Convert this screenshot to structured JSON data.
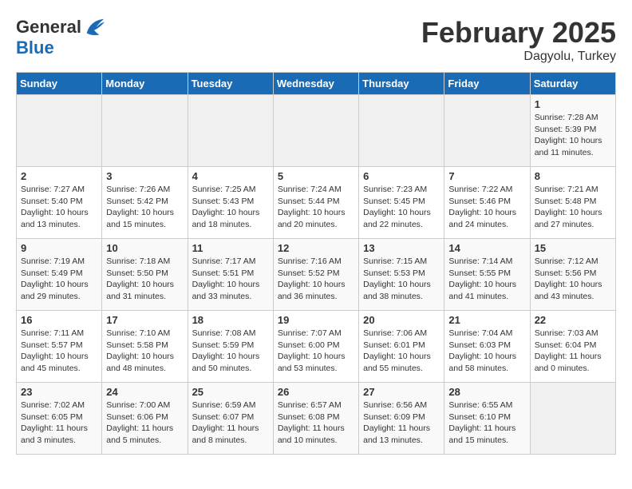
{
  "header": {
    "logo_line1": "General",
    "logo_line2": "Blue",
    "month_title": "February 2025",
    "location": "Dagyolu, Turkey"
  },
  "days_of_week": [
    "Sunday",
    "Monday",
    "Tuesday",
    "Wednesday",
    "Thursday",
    "Friday",
    "Saturday"
  ],
  "weeks": [
    [
      {
        "day": "",
        "info": ""
      },
      {
        "day": "",
        "info": ""
      },
      {
        "day": "",
        "info": ""
      },
      {
        "day": "",
        "info": ""
      },
      {
        "day": "",
        "info": ""
      },
      {
        "day": "",
        "info": ""
      },
      {
        "day": "1",
        "info": "Sunrise: 7:28 AM\nSunset: 5:39 PM\nDaylight: 10 hours\nand 11 minutes."
      }
    ],
    [
      {
        "day": "2",
        "info": "Sunrise: 7:27 AM\nSunset: 5:40 PM\nDaylight: 10 hours\nand 13 minutes."
      },
      {
        "day": "3",
        "info": "Sunrise: 7:26 AM\nSunset: 5:42 PM\nDaylight: 10 hours\nand 15 minutes."
      },
      {
        "day": "4",
        "info": "Sunrise: 7:25 AM\nSunset: 5:43 PM\nDaylight: 10 hours\nand 18 minutes."
      },
      {
        "day": "5",
        "info": "Sunrise: 7:24 AM\nSunset: 5:44 PM\nDaylight: 10 hours\nand 20 minutes."
      },
      {
        "day": "6",
        "info": "Sunrise: 7:23 AM\nSunset: 5:45 PM\nDaylight: 10 hours\nand 22 minutes."
      },
      {
        "day": "7",
        "info": "Sunrise: 7:22 AM\nSunset: 5:46 PM\nDaylight: 10 hours\nand 24 minutes."
      },
      {
        "day": "8",
        "info": "Sunrise: 7:21 AM\nSunset: 5:48 PM\nDaylight: 10 hours\nand 27 minutes."
      }
    ],
    [
      {
        "day": "9",
        "info": "Sunrise: 7:19 AM\nSunset: 5:49 PM\nDaylight: 10 hours\nand 29 minutes."
      },
      {
        "day": "10",
        "info": "Sunrise: 7:18 AM\nSunset: 5:50 PM\nDaylight: 10 hours\nand 31 minutes."
      },
      {
        "day": "11",
        "info": "Sunrise: 7:17 AM\nSunset: 5:51 PM\nDaylight: 10 hours\nand 33 minutes."
      },
      {
        "day": "12",
        "info": "Sunrise: 7:16 AM\nSunset: 5:52 PM\nDaylight: 10 hours\nand 36 minutes."
      },
      {
        "day": "13",
        "info": "Sunrise: 7:15 AM\nSunset: 5:53 PM\nDaylight: 10 hours\nand 38 minutes."
      },
      {
        "day": "14",
        "info": "Sunrise: 7:14 AM\nSunset: 5:55 PM\nDaylight: 10 hours\nand 41 minutes."
      },
      {
        "day": "15",
        "info": "Sunrise: 7:12 AM\nSunset: 5:56 PM\nDaylight: 10 hours\nand 43 minutes."
      }
    ],
    [
      {
        "day": "16",
        "info": "Sunrise: 7:11 AM\nSunset: 5:57 PM\nDaylight: 10 hours\nand 45 minutes."
      },
      {
        "day": "17",
        "info": "Sunrise: 7:10 AM\nSunset: 5:58 PM\nDaylight: 10 hours\nand 48 minutes."
      },
      {
        "day": "18",
        "info": "Sunrise: 7:08 AM\nSunset: 5:59 PM\nDaylight: 10 hours\nand 50 minutes."
      },
      {
        "day": "19",
        "info": "Sunrise: 7:07 AM\nSunset: 6:00 PM\nDaylight: 10 hours\nand 53 minutes."
      },
      {
        "day": "20",
        "info": "Sunrise: 7:06 AM\nSunset: 6:01 PM\nDaylight: 10 hours\nand 55 minutes."
      },
      {
        "day": "21",
        "info": "Sunrise: 7:04 AM\nSunset: 6:03 PM\nDaylight: 10 hours\nand 58 minutes."
      },
      {
        "day": "22",
        "info": "Sunrise: 7:03 AM\nSunset: 6:04 PM\nDaylight: 11 hours\nand 0 minutes."
      }
    ],
    [
      {
        "day": "23",
        "info": "Sunrise: 7:02 AM\nSunset: 6:05 PM\nDaylight: 11 hours\nand 3 minutes."
      },
      {
        "day": "24",
        "info": "Sunrise: 7:00 AM\nSunset: 6:06 PM\nDaylight: 11 hours\nand 5 minutes."
      },
      {
        "day": "25",
        "info": "Sunrise: 6:59 AM\nSunset: 6:07 PM\nDaylight: 11 hours\nand 8 minutes."
      },
      {
        "day": "26",
        "info": "Sunrise: 6:57 AM\nSunset: 6:08 PM\nDaylight: 11 hours\nand 10 minutes."
      },
      {
        "day": "27",
        "info": "Sunrise: 6:56 AM\nSunset: 6:09 PM\nDaylight: 11 hours\nand 13 minutes."
      },
      {
        "day": "28",
        "info": "Sunrise: 6:55 AM\nSunset: 6:10 PM\nDaylight: 11 hours\nand 15 minutes."
      },
      {
        "day": "",
        "info": ""
      }
    ]
  ]
}
